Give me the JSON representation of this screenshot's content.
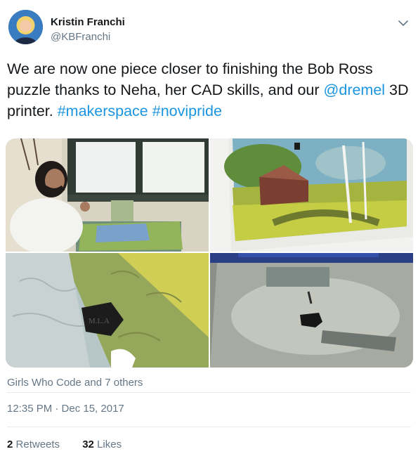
{
  "author": {
    "name": "Kristin Franchi",
    "handle": "@KBFranchi",
    "avatar_icon": "profile-photo-icon"
  },
  "tweet": {
    "text_part1": "We are now one piece closer to finishing the Bob Ross puzzle thanks to Neha, her CAD skills, and our ",
    "mention": "@dremel",
    "text_part2": " 3D printer. ",
    "hashtag1": "#makerspace",
    "space": " ",
    "hashtag2": "#novipride"
  },
  "media": {
    "photos": [
      "photo-girl-with-puzzle",
      "photo-completed-puzzle-cabin",
      "photo-puzzle-closeup-printed-piece",
      "photo-printed-piece-on-bed"
    ],
    "piece_label": "M.L.A"
  },
  "liked_by": "Girls Who Code and 7 others",
  "timestamp": "12:35 PM · Dec 15, 2017",
  "stats": {
    "retweets_count": "2",
    "retweets_label": "Retweets",
    "likes_count": "32",
    "likes_label": "Likes"
  },
  "colors": {
    "link": "#1b95e0",
    "secondary_text": "#657786",
    "primary_text": "#14171a",
    "divider": "#e6ecf0"
  }
}
